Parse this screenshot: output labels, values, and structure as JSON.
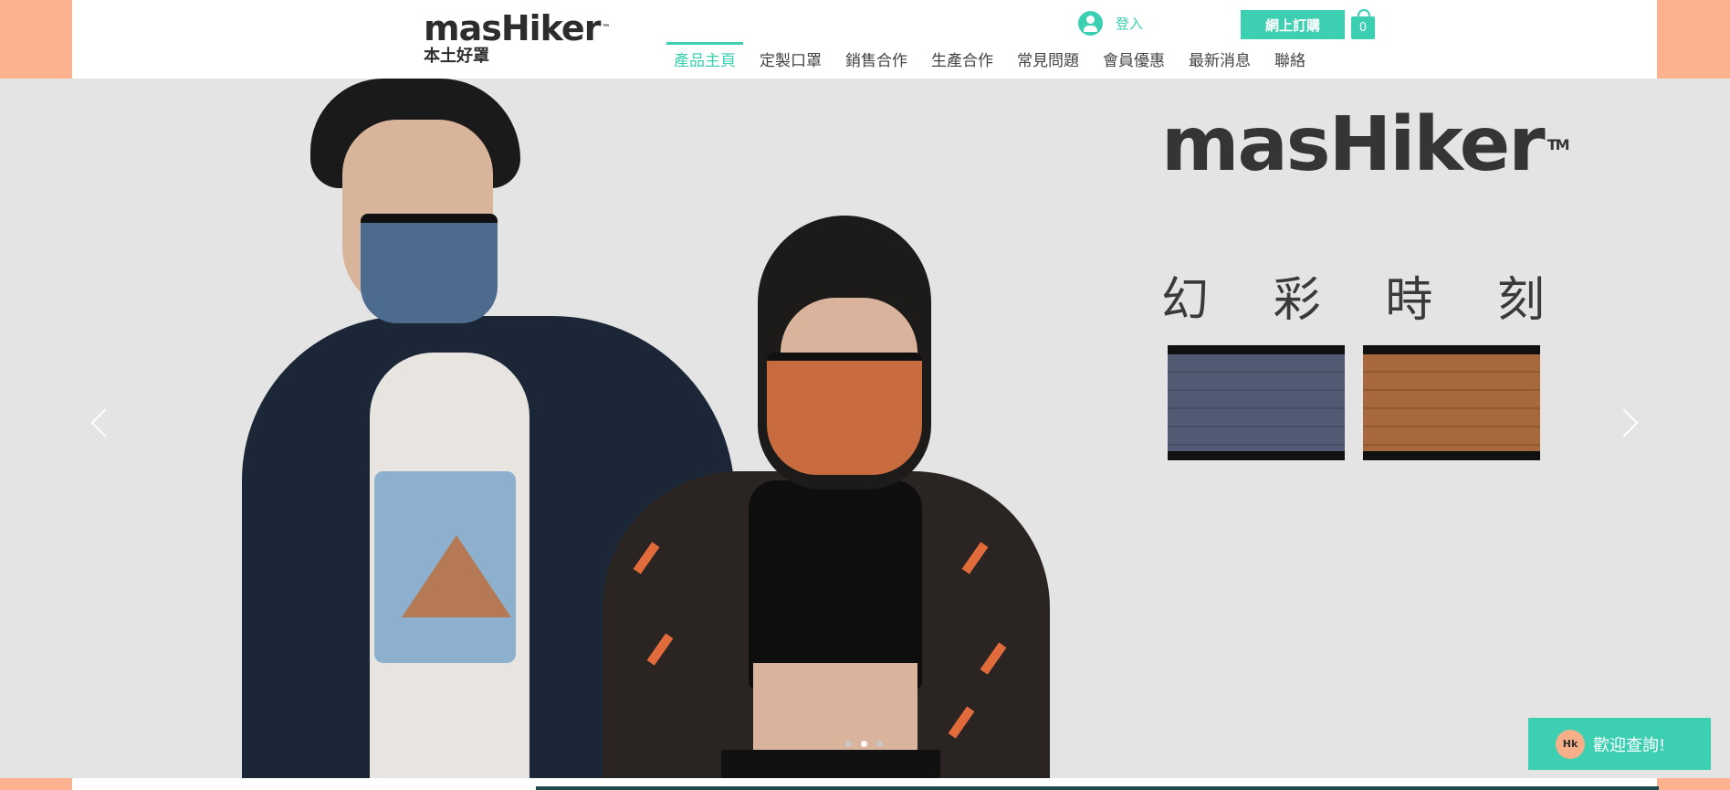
{
  "header": {
    "logo_word": "masHiker",
    "logo_tm": "™",
    "logo_sub": "本土好罩",
    "login_label": "登入",
    "order_button": "網上訂購",
    "cart_count": "0"
  },
  "nav": {
    "items": [
      "產品主頁",
      "定製口罩",
      "銷售合作",
      "生產合作",
      "常見問題",
      "會員優惠",
      "最新消息",
      "聯絡"
    ],
    "active_index": 0
  },
  "hero": {
    "brand": "masHiker",
    "brand_tm": "TM",
    "tagline": [
      "幻",
      "彩",
      "時",
      "刻"
    ],
    "slides_total": 3,
    "active_slide": 1
  },
  "chat": {
    "icon_text": "Hk",
    "label": "歡迎查詢!"
  },
  "colors": {
    "accent": "#3ccfb1",
    "side_panel": "#fdb28f",
    "hero_bg": "#e4e4e4"
  }
}
